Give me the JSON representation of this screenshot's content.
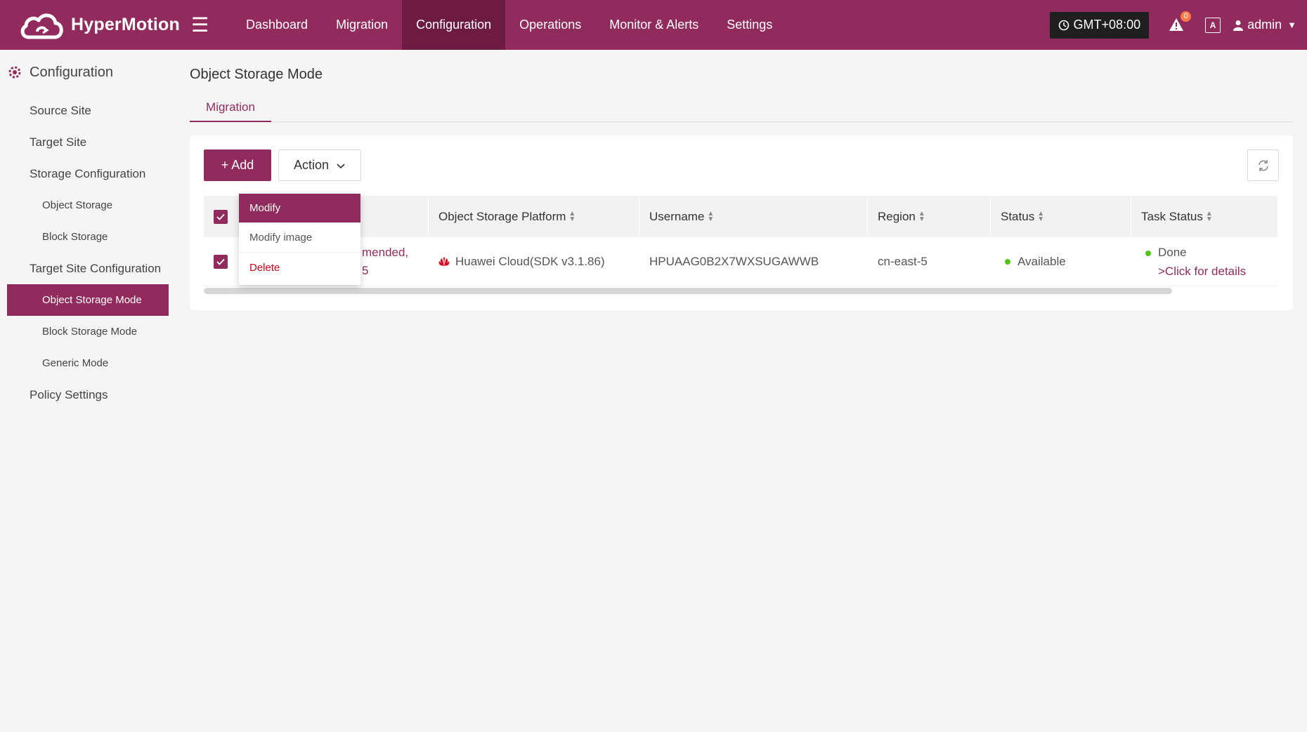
{
  "app": {
    "name": "HyperMotion"
  },
  "nav": {
    "items": [
      {
        "label": "Dashboard"
      },
      {
        "label": "Migration"
      },
      {
        "label": "Configuration",
        "active": true
      },
      {
        "label": "Operations"
      },
      {
        "label": "Monitor & Alerts"
      },
      {
        "label": "Settings"
      }
    ],
    "timezone": "GMT+08:00",
    "alert_count": "0",
    "lang_icon": "A",
    "user": "admin"
  },
  "sidebar": {
    "heading": "Configuration",
    "items": {
      "source_site": "Source Site",
      "target_site": "Target Site",
      "storage_configuration": "Storage Configuration",
      "object_storage": "Object Storage",
      "block_storage": "Block Storage",
      "target_site_configuration": "Target Site Configuration",
      "object_storage_mode": "Object Storage Mode",
      "block_storage_mode": "Block Storage Mode",
      "generic_mode": "Generic Mode",
      "policy_settings": "Policy Settings"
    }
  },
  "page": {
    "title": "Object Storage Mode",
    "tab": "Migration",
    "add_label": "+ Add",
    "action_label": "Action"
  },
  "table": {
    "headers": {
      "platform": "Object Storage Platform",
      "username": "Username",
      "region": "Region",
      "status": "Status",
      "task_status": "Task Status"
    },
    "row": {
      "name_line1": "mended,",
      "name_line2": "5",
      "platform": "Huawei Cloud(SDK v3.1.86)",
      "username": "HPUAAG0B2X7WXSUGAWWB",
      "region": "cn-east-5",
      "status": "Available",
      "task_status": "Done",
      "task_link": ">Click for details"
    }
  },
  "dropdown": {
    "modify": "Modify",
    "modify_image": "Modify image",
    "delete": "Delete"
  },
  "colors": {
    "brand": "#922b5d",
    "nav_active": "#6d1b43",
    "success": "#52c41a",
    "danger": "#d0021b"
  }
}
